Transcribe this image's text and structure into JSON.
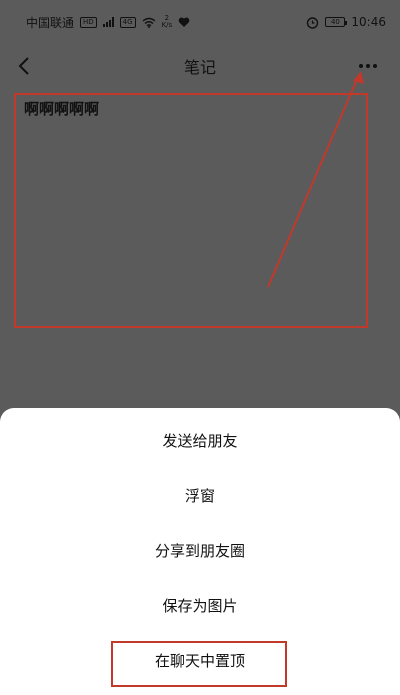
{
  "status_bar": {
    "carrier": "中国联通",
    "hd_badge": "HD",
    "network_badge": "4G",
    "speed_value": "2",
    "speed_unit": "K/s",
    "battery_level": "40",
    "time": "10:46"
  },
  "nav": {
    "title": "笔记"
  },
  "note": {
    "content": "啊啊啊啊啊"
  },
  "action_sheet": {
    "items": [
      {
        "label": "发送给朋友"
      },
      {
        "label": "浮窗"
      },
      {
        "label": "分享到朋友圈"
      },
      {
        "label": "保存为图片"
      },
      {
        "label": "在聊天中置顶"
      }
    ]
  },
  "colors": {
    "overlay": "#5b5b5b",
    "sheet": "#ffffff",
    "annotation": "#c0392b"
  },
  "icons": {
    "back": "chevron-left-icon",
    "more": "more-horizontal-icon",
    "wifi": "wifi-icon",
    "signal": "signal-icon",
    "heart": "heart-icon",
    "alarm": "alarm-icon",
    "battery": "battery-icon"
  }
}
